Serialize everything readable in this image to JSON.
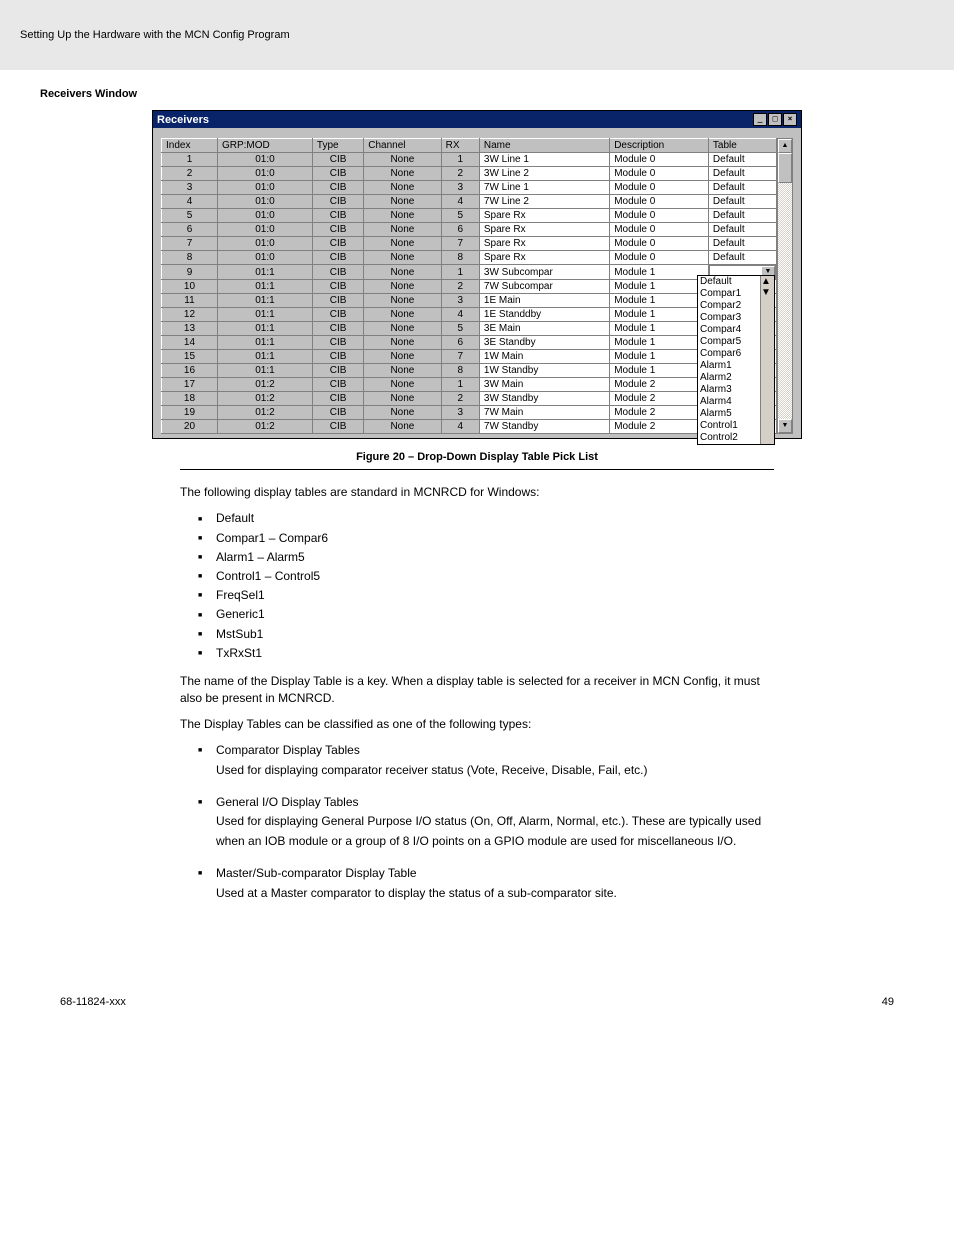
{
  "header": {
    "left_line": "Setting Up the Hardware with the MCN Config Program",
    "title_small": "Receivers Window"
  },
  "window": {
    "title": "Receivers",
    "columns": [
      "Index",
      "GRP:MOD",
      "Type",
      "Channel",
      "RX",
      "Name",
      "Description",
      "Table"
    ],
    "rows": [
      {
        "idx": "1",
        "gm": "01:0",
        "type": "CIB",
        "ch": "None",
        "rx": "1",
        "name": "3W Line 1",
        "desc": "Module 0",
        "table": "Default"
      },
      {
        "idx": "2",
        "gm": "01:0",
        "type": "CIB",
        "ch": "None",
        "rx": "2",
        "name": "3W Line 2",
        "desc": "Module 0",
        "table": "Default"
      },
      {
        "idx": "3",
        "gm": "01:0",
        "type": "CIB",
        "ch": "None",
        "rx": "3",
        "name": "7W Line 1",
        "desc": "Module 0",
        "table": "Default"
      },
      {
        "idx": "4",
        "gm": "01:0",
        "type": "CIB",
        "ch": "None",
        "rx": "4",
        "name": "7W Line 2",
        "desc": "Module 0",
        "table": "Default"
      },
      {
        "idx": "5",
        "gm": "01:0",
        "type": "CIB",
        "ch": "None",
        "rx": "5",
        "name": "Spare Rx",
        "desc": "Module 0",
        "table": "Default"
      },
      {
        "idx": "6",
        "gm": "01:0",
        "type": "CIB",
        "ch": "None",
        "rx": "6",
        "name": "Spare Rx",
        "desc": "Module 0",
        "table": "Default"
      },
      {
        "idx": "7",
        "gm": "01:0",
        "type": "CIB",
        "ch": "None",
        "rx": "7",
        "name": "Spare Rx",
        "desc": "Module 0",
        "table": "Default"
      },
      {
        "idx": "8",
        "gm": "01:0",
        "type": "CIB",
        "ch": "None",
        "rx": "8",
        "name": "Spare Rx",
        "desc": "Module 0",
        "table": "Default"
      },
      {
        "idx": "9",
        "gm": "01:1",
        "type": "CIB",
        "ch": "None",
        "rx": "1",
        "name": "3W Subcompar",
        "desc": "Module 1",
        "table": ""
      },
      {
        "idx": "10",
        "gm": "01:1",
        "type": "CIB",
        "ch": "None",
        "rx": "2",
        "name": "7W Subcompar",
        "desc": "Module 1",
        "table": ""
      },
      {
        "idx": "11",
        "gm": "01:1",
        "type": "CIB",
        "ch": "None",
        "rx": "3",
        "name": "1E Main",
        "desc": "Module 1",
        "table": ""
      },
      {
        "idx": "12",
        "gm": "01:1",
        "type": "CIB",
        "ch": "None",
        "rx": "4",
        "name": "1E Standdby",
        "desc": "Module 1",
        "table": ""
      },
      {
        "idx": "13",
        "gm": "01:1",
        "type": "CIB",
        "ch": "None",
        "rx": "5",
        "name": "3E Main",
        "desc": "Module 1",
        "table": ""
      },
      {
        "idx": "14",
        "gm": "01:1",
        "type": "CIB",
        "ch": "None",
        "rx": "6",
        "name": "3E Standby",
        "desc": "Module 1",
        "table": ""
      },
      {
        "idx": "15",
        "gm": "01:1",
        "type": "CIB",
        "ch": "None",
        "rx": "7",
        "name": "1W Main",
        "desc": "Module 1",
        "table": ""
      },
      {
        "idx": "16",
        "gm": "01:1",
        "type": "CIB",
        "ch": "None",
        "rx": "8",
        "name": "1W Standby",
        "desc": "Module 1",
        "table": ""
      },
      {
        "idx": "17",
        "gm": "01:2",
        "type": "CIB",
        "ch": "None",
        "rx": "1",
        "name": "3W Main",
        "desc": "Module 2",
        "table": ""
      },
      {
        "idx": "18",
        "gm": "01:2",
        "type": "CIB",
        "ch": "None",
        "rx": "2",
        "name": "3W Standby",
        "desc": "Module 2",
        "table": ""
      },
      {
        "idx": "19",
        "gm": "01:2",
        "type": "CIB",
        "ch": "None",
        "rx": "3",
        "name": "7W Main",
        "desc": "Module 2",
        "table": ""
      },
      {
        "idx": "20",
        "gm": "01:2",
        "type": "CIB",
        "ch": "None",
        "rx": "4",
        "name": "7W Standby",
        "desc": "Module 2",
        "table": ""
      }
    ],
    "dropdown_options": [
      "Default",
      "Compar1",
      "Compar2",
      "Compar3",
      "Compar4",
      "Compar5",
      "Compar6",
      "Alarm1",
      "Alarm2",
      "Alarm3",
      "Alarm4",
      "Alarm5",
      "Control1",
      "Control2"
    ]
  },
  "figure_caption": "Figure 20 – Drop-Down Display Table Pick List",
  "section1": {
    "lead": "The following display tables are standard in MCNRCD for Windows:",
    "items": [
      "Default",
      "Compar1 – Compar6",
      "Alarm1 – Alarm5",
      "Control1 – Control5",
      "FreqSel1",
      "Generic1",
      "MstSub1",
      "TxRxSt1"
    ],
    "tail": "The name of the Display Table is a key. When a display table is selected for a receiver in MCN Config, it must also be present in MCNRCD."
  },
  "section2": {
    "lead": "The Display Tables can be classified as one of the following types:",
    "items": [
      "Comparator Display Tables\nUsed for displaying comparator receiver status (Vote, Receive, Disable, Fail, etc.)",
      "General I/O Display Tables\nUsed for displaying General Purpose I/O status (On, Off, Alarm, Normal, etc.). These are typically used when an IOB module or a group of 8 I/O points on a GPIO module are used for miscellaneous I/O.",
      "Master/Sub-comparator Display Table\nUsed at a Master comparator to display the status of a sub-comparator site."
    ]
  },
  "footer": {
    "left": "68-11824-xxx",
    "right": "49"
  }
}
